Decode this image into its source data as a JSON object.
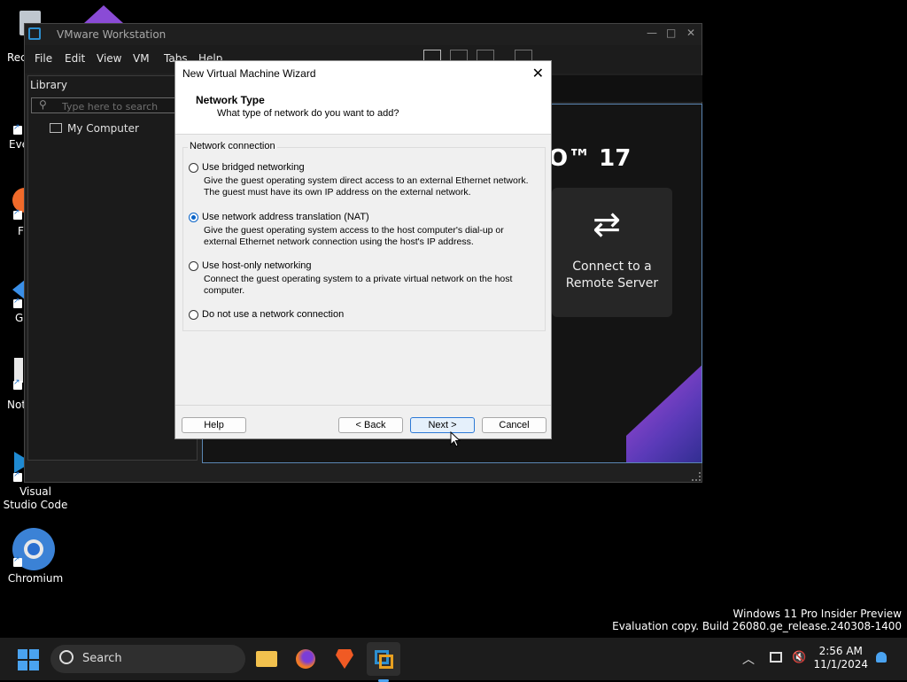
{
  "desktop": {
    "icons": [
      {
        "label": "Rec"
      },
      {
        "label": "Eve"
      },
      {
        "label": "F"
      },
      {
        "label": "G"
      },
      {
        "label": "Not"
      },
      {
        "label": "Visual Studio Code"
      },
      {
        "label": "Chromium"
      }
    ]
  },
  "vmware": {
    "title": "VMware Workstation",
    "menu": [
      "File",
      "Edit",
      "View",
      "VM",
      "Tabs",
      "Help"
    ],
    "library": {
      "header": "Library",
      "search_placeholder": "Type here to search",
      "tree": [
        "My Computer"
      ]
    },
    "home": {
      "brand_fragment": "O™ 17",
      "remote_card": "Connect to a Remote Server"
    }
  },
  "wizard": {
    "title": "New Virtual Machine Wizard",
    "heading": "Network Type",
    "subheading": "What type of network do you want to add?",
    "group_label": "Network connection",
    "options": [
      {
        "label": "Use bridged networking",
        "desc": "Give the guest operating system direct access to an external Ethernet network. The guest must have its own IP address on the external network.",
        "selected": false
      },
      {
        "label": "Use network address translation (NAT)",
        "desc": "Give the guest operating system access to the host computer's dial-up or external Ethernet network connection using the host's IP address.",
        "selected": true
      },
      {
        "label": "Use host-only networking",
        "desc": "Connect the guest operating system to a private virtual network on the host computer.",
        "selected": false
      },
      {
        "label": "Do not use a network connection",
        "desc": "",
        "selected": false
      }
    ],
    "buttons": {
      "help": "Help",
      "back": "< Back",
      "next": "Next >",
      "cancel": "Cancel"
    }
  },
  "watermark": {
    "line1": "Windows 11 Pro Insider Preview",
    "line2": "Evaluation copy. Build 26080.ge_release.240308-1400"
  },
  "taskbar": {
    "search_label": "Search",
    "time": "2:56 AM",
    "date": "11/1/2024"
  }
}
